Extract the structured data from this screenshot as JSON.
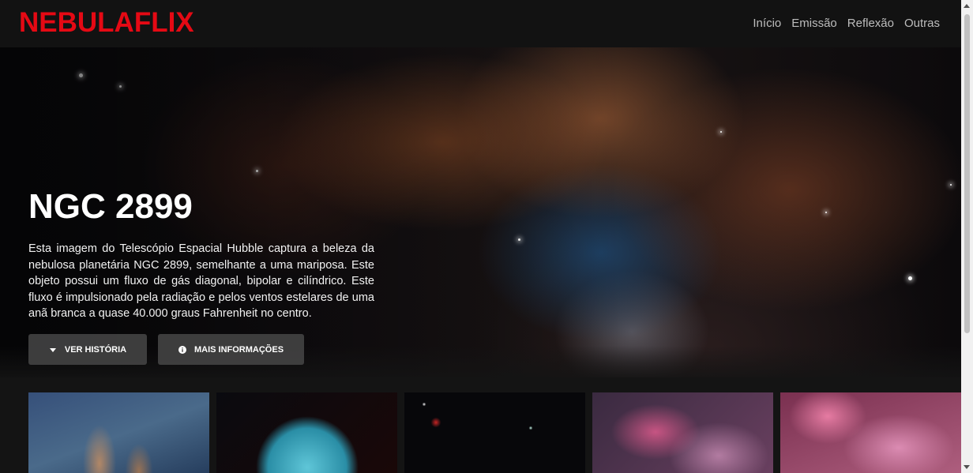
{
  "brand": {
    "name": "NEBULAFLIX",
    "color": "#e50914"
  },
  "nav": {
    "items": [
      {
        "label": "Início"
      },
      {
        "label": "Emissão"
      },
      {
        "label": "Reflexão"
      },
      {
        "label": "Outras"
      }
    ]
  },
  "hero": {
    "title": "NGC 2899",
    "description": "Esta imagem do Telescópio Espacial Hubble captura a beleza da nebulosa planetária NGC 2899, semelhante a uma mariposa. Este objeto possui um fluxo de gás diagonal, bipolar e cilíndrico. Este fluxo é impulsionado pela radiação e pelos ventos estelares de uma anã branca a quase 40.000 graus Fahrenheit no centro.",
    "buttons": {
      "story": {
        "label": "VER HISTÓRIA",
        "icon": "caret-down-icon"
      },
      "info": {
        "label": "MAIS INFORMAÇÕES",
        "icon": "info-circle-icon"
      }
    }
  },
  "thumbnails": [
    {
      "image": "nebula-pillars-image"
    },
    {
      "image": "nebula-blue-sphere-image"
    },
    {
      "image": "star-field-image"
    },
    {
      "image": "nebula-pink-image"
    },
    {
      "image": "nebula-orion-image"
    }
  ]
}
